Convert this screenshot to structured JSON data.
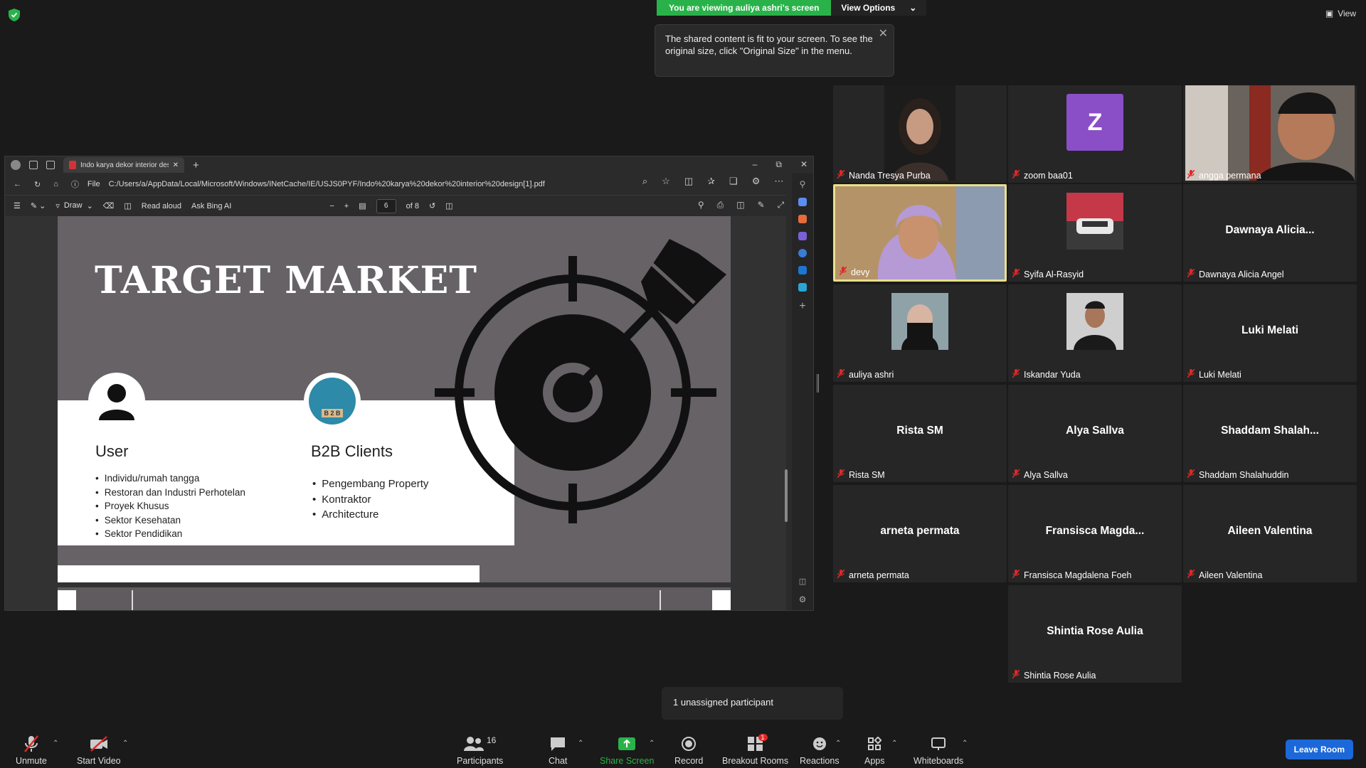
{
  "banner": {
    "viewing": "You are viewing auliya ashri's screen",
    "view_options": "View Options",
    "view_top": "View"
  },
  "tooltip": {
    "text": "The shared content is fit to your screen. To see the original size, click \"Original Size\" in the menu."
  },
  "browser": {
    "tab_title": "Indo karya dekor interior design",
    "file_label": "File",
    "url": "C:/Users/a/AppData/Local/Microsoft/Windows/INetCache/IE/USJS0PYF/Indo%20karya%20dekor%20interior%20design[1].pdf",
    "draw_label": "Draw",
    "read_aloud": "Read aloud",
    "ask_bing": "Ask Bing AI",
    "page_current": "6",
    "page_total": "of 8"
  },
  "slide": {
    "title": "TARGET MARKET",
    "col1_title": "User",
    "col1_items": [
      "Individu/rumah tangga",
      "Restoran dan Industri Perhotelan",
      "Proyek Khusus",
      "Sektor Kesehatan",
      "Sektor Pendidikan"
    ],
    "col2_title": "B2B Clients",
    "col2_items": [
      "Pengembang Property",
      "Kontraktor",
      "Architecture"
    ],
    "b2b_badge": "B 2 B"
  },
  "participants": [
    {
      "name": "Nanda Tresya Purba",
      "display": "",
      "photo": "woman1"
    },
    {
      "name": "zoom baa01",
      "display": "Z",
      "photo": "letter"
    },
    {
      "name": "angga permana",
      "display": "",
      "photo": "man1"
    },
    {
      "name": "devy",
      "display": "",
      "photo": "woman2",
      "active": true
    },
    {
      "name": "Syifa Al-Rasyid",
      "display": "",
      "photo": "car"
    },
    {
      "name": "Dawnaya Alicia Angel",
      "display": "Dawnaya  Alicia...",
      "photo": ""
    },
    {
      "name": "auliya ashri",
      "display": "",
      "photo": "woman3"
    },
    {
      "name": "Iskandar Yuda",
      "display": "",
      "photo": "man2"
    },
    {
      "name": "Luki Melati",
      "display": "Luki Melati",
      "photo": ""
    },
    {
      "name": "Rista SM",
      "display": "Rista SM",
      "photo": ""
    },
    {
      "name": "Alya Sallva",
      "display": "Alya Sallva",
      "photo": ""
    },
    {
      "name": "Shaddam Shalahuddin",
      "display": "Shaddam  Shalah...",
      "photo": ""
    },
    {
      "name": "arneta permata",
      "display": "arneta permata",
      "photo": ""
    },
    {
      "name": "Fransisca Magdalena Foeh",
      "display": "Fransisca  Magda...",
      "photo": ""
    },
    {
      "name": "Aileen Valentina",
      "display": "Aileen Valentina",
      "photo": ""
    },
    {
      "name": "Shintia Rose Aulia",
      "display": "Shintia Rose Aulia",
      "photo": ""
    }
  ],
  "unassigned": "1 unassigned participant",
  "toolbar": {
    "unmute": "Unmute",
    "start_video": "Start Video",
    "participants": "Participants",
    "participants_count": "16",
    "chat": "Chat",
    "share_screen": "Share Screen",
    "record": "Record",
    "breakout_rooms": "Breakout Rooms",
    "breakout_badge": "1",
    "reactions": "Reactions",
    "apps": "Apps",
    "whiteboards": "Whiteboards",
    "leave": "Leave Room"
  },
  "colors": {
    "share_green": "#2ab24a",
    "leave_blue": "#1c68d9",
    "active_speaker": "#e8e08a",
    "muted_red": "#e02828"
  }
}
